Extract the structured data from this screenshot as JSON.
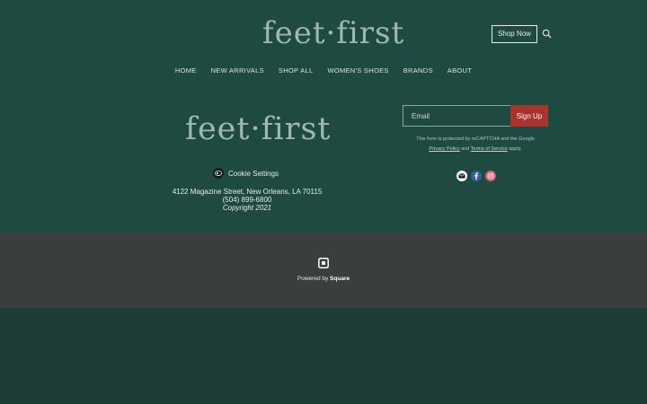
{
  "header": {
    "logo_text": "feet·first",
    "shop_now_label": "Shop Now",
    "search_icon": "search-icon"
  },
  "nav": {
    "items": [
      {
        "label": "HOME"
      },
      {
        "label": "NEW ARRIVALS"
      },
      {
        "label": "SHOP ALL"
      },
      {
        "label": "WOMEN'S SHOES"
      },
      {
        "label": "BRANDS"
      },
      {
        "label": "ABOUT"
      }
    ]
  },
  "footer": {
    "logo_text": "feet·first",
    "cookie_label": "Cookie Settings",
    "cookie_icon": "cookie-icon",
    "address": "4122 Magazine Street, New Orleans, LA 70115",
    "phone": "(504) 899-6800",
    "copyright": "Copyright 2021"
  },
  "newsletter": {
    "email_placeholder": "Email",
    "email_value": "",
    "signup_label": "Sign Up",
    "recaptcha_text": "This form is protected by reCAPTCHA and the Google",
    "privacy_label": "Privacy Policy",
    "and_text": "and",
    "terms_label": "Terms of Service",
    "apply_text": "apply."
  },
  "socials": {
    "items": [
      {
        "icon": "email-icon",
        "color": "#ffffff"
      },
      {
        "icon": "facebook-icon",
        "color": "#3b5b99"
      },
      {
        "icon": "instagram-icon",
        "color": "#d85b73"
      }
    ]
  },
  "powered": {
    "prefix": "Powered by",
    "brand": "Square",
    "icon": "square-logo-icon"
  },
  "colors": {
    "top_background": "#1f4a41",
    "power_band": "#3a3f3e",
    "signup_button": "#a8342e"
  }
}
